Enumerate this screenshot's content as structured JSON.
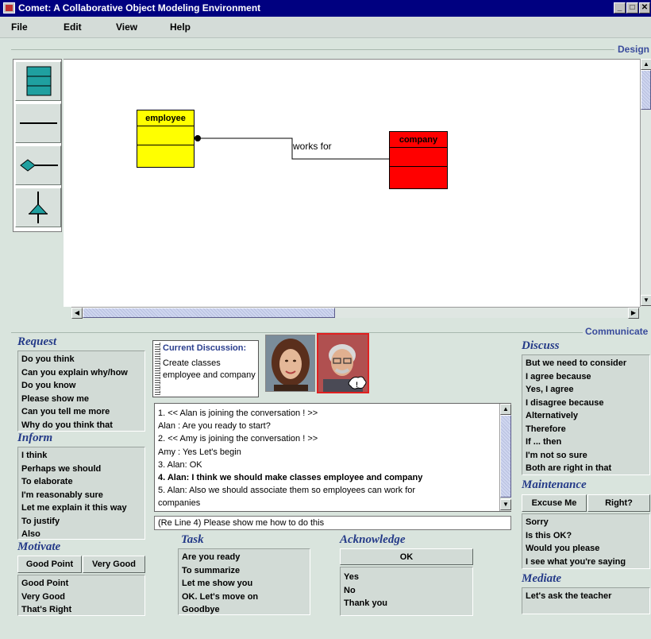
{
  "window": {
    "title": "Comet: A Collaborative Object Modeling Environment"
  },
  "menu": [
    "File",
    "Edit",
    "View",
    "Help"
  ],
  "design": {
    "section_label": "Design",
    "palette_tools": [
      "class-tool-icon",
      "line-tool-icon",
      "aggregation-tool-icon",
      "inheritance-tool-icon"
    ],
    "classes": [
      {
        "name": "employee",
        "color": "#ffff00"
      },
      {
        "name": "company",
        "color": "#ff0000"
      }
    ],
    "association_label": "works for"
  },
  "communicate": {
    "section_label": "Communicate",
    "request": {
      "title": "Request",
      "items": [
        "Do you think",
        "Can you explain why/how",
        "Do you know",
        "Please show me",
        "Can you tell me more",
        "Why do you think that"
      ]
    },
    "inform": {
      "title": "Inform",
      "items": [
        "I think",
        "Perhaps we should",
        "To elaborate",
        "I'm reasonably sure",
        "Let me explain it this way",
        "To justify",
        "Also"
      ]
    },
    "motivate": {
      "title": "Motivate",
      "buttons": [
        "Good Point",
        "Very Good"
      ],
      "items": [
        "Good Point",
        "Very Good",
        "That's Right"
      ]
    },
    "task": {
      "title": "Task",
      "items": [
        "Are you ready",
        "To summarize",
        "Let me show you",
        "OK. Let's move on",
        "Goodbye"
      ]
    },
    "acknowledge": {
      "title": "Acknowledge",
      "button": "OK",
      "items": [
        "Yes",
        "No",
        "Thank you"
      ]
    },
    "discuss": {
      "title": "Discuss",
      "items": [
        "But we need to consider",
        "I agree because",
        "Yes, I agree",
        "I disagree because",
        "Alternatively",
        "Therefore",
        "If ... then",
        "I'm not so sure",
        "Both are right in that"
      ]
    },
    "maintenance": {
      "title": "Maintenance",
      "buttons": [
        "Excuse Me",
        "Right?"
      ],
      "items": [
        "Sorry",
        "Is this OK?",
        "Would you please",
        "I see what you're saying"
      ]
    },
    "mediate": {
      "title": "Mediate",
      "items": [
        "Let's ask the teacher"
      ]
    },
    "discussion": {
      "title": "Current Discussion:",
      "body": "Create classes employee and company"
    },
    "chat": [
      "1. << Alan is joining the conversation ! >>",
      "Alan : Are you ready to start?",
      "2. << Amy is joining the conversation ! >>",
      "Amy : Yes Let's begin",
      "3. Alan: OK",
      "4. Alan: I think we should make classes employee and company",
      "5. Alan: Also we should associate them so employees can work for",
      "companies"
    ],
    "chat_bold_index": 5,
    "input_value": "(Re Line 4) Please show me how to do this"
  }
}
